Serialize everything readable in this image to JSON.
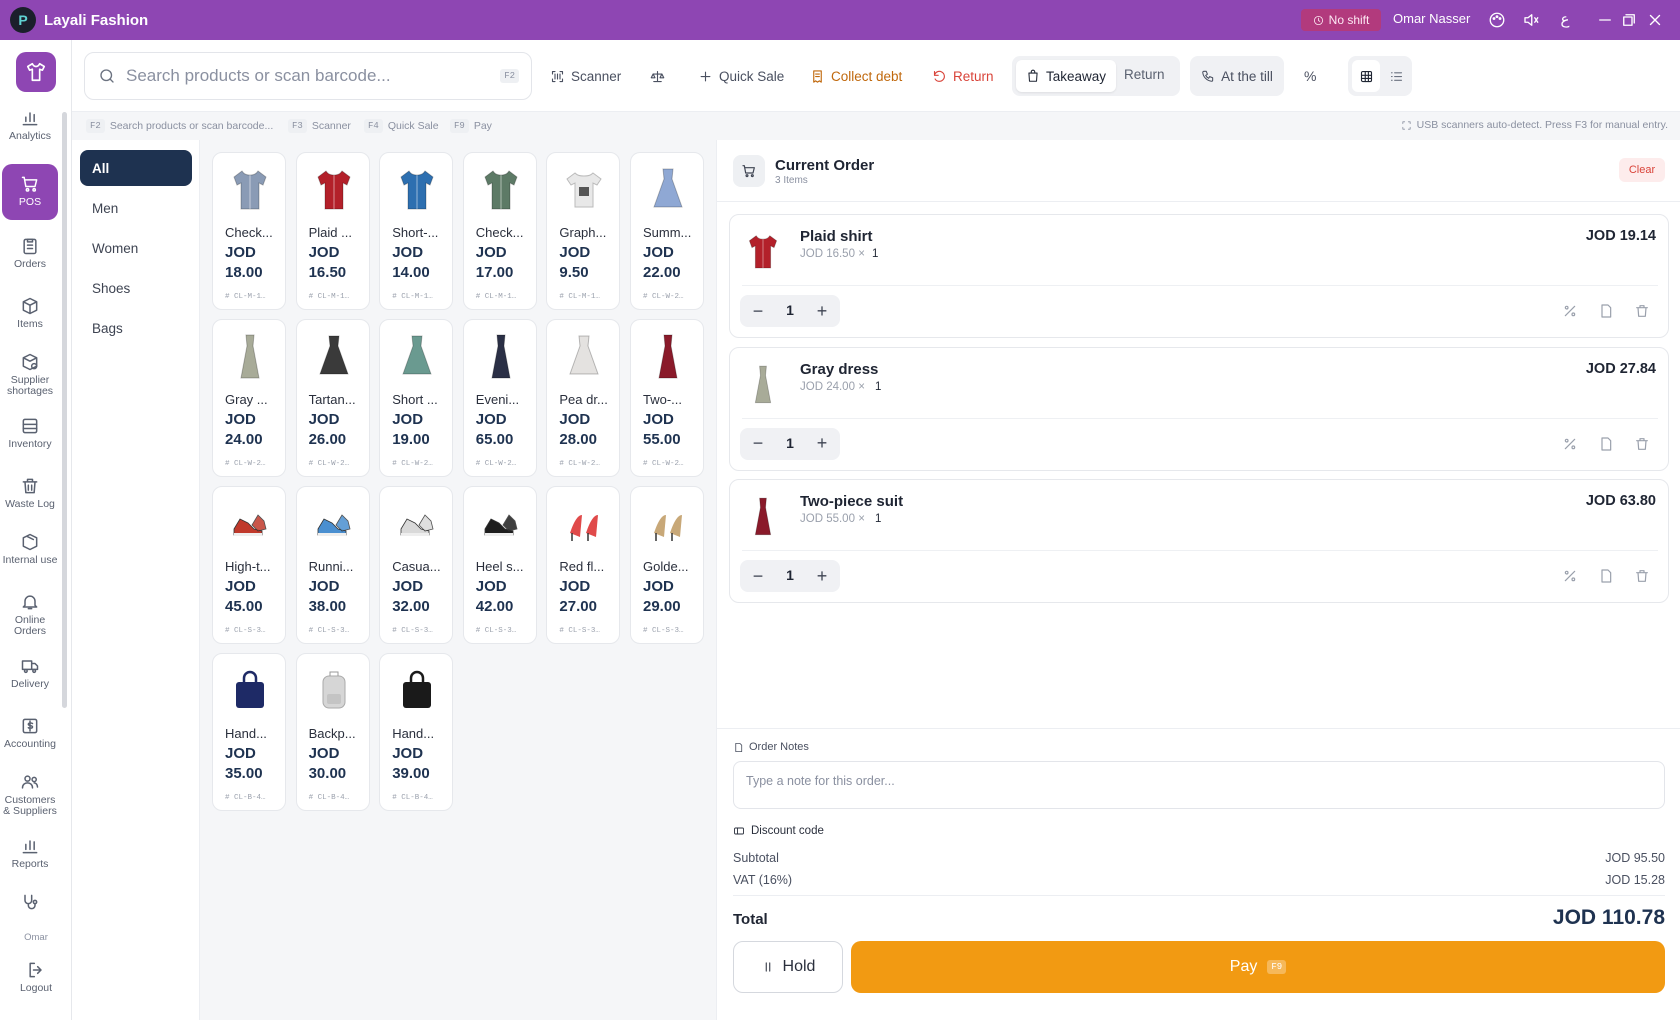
{
  "app": {
    "title": "Layali Fashion",
    "brand_color": "#8e46b3"
  },
  "titlebar": {
    "shift_status": "No shift",
    "user_name": "Omar Nasser"
  },
  "sidebar": {
    "items": [
      {
        "label": "Analytics",
        "icon": "chart-icon"
      },
      {
        "label": "POS",
        "icon": "cart-icon",
        "active": true
      },
      {
        "label": "Orders",
        "icon": "clipboard-icon"
      },
      {
        "label": "Items",
        "icon": "box-icon"
      },
      {
        "label": "Supplier shortages",
        "icon": "box-alert-icon"
      },
      {
        "label": "Inventory",
        "icon": "warehouse-icon"
      },
      {
        "label": "Waste Log",
        "icon": "trash-icon"
      },
      {
        "label": "Internal use",
        "icon": "package-icon"
      },
      {
        "label": "Online Orders",
        "icon": "bell-icon"
      },
      {
        "label": "Delivery",
        "icon": "truck-icon"
      },
      {
        "label": "Accounting",
        "icon": "dollar-icon"
      },
      {
        "label": "Customers & Suppliers",
        "icon": "users-icon"
      },
      {
        "label": "Reports",
        "icon": "bar-chart-icon"
      }
    ],
    "user_short": "Omar",
    "logout_label": "Logout"
  },
  "toolbar": {
    "search_placeholder": "Search products or scan barcode...",
    "search_shortcut": "F2",
    "scanner_label": "Scanner",
    "quick_sale_label": "Quick Sale",
    "collect_debt_label": "Collect debt",
    "return_label": "Return",
    "mode_takeaway": "Takeaway",
    "mode_return": "Return",
    "at_till_label": "At the till",
    "percent_label": "%"
  },
  "hints": {
    "search": {
      "key": "F2",
      "text": "Search products or scan barcode..."
    },
    "scanner": {
      "key": "F3",
      "text": "Scanner"
    },
    "quick_sale": {
      "key": "F4",
      "text": "Quick Sale"
    },
    "pay": {
      "key": "F9",
      "text": "Pay"
    },
    "usb_note": "USB scanners auto-detect. Press F3 for manual entry."
  },
  "categories": [
    "All",
    "Men",
    "Women",
    "Shoes",
    "Bags"
  ],
  "products": [
    {
      "name": "Check...",
      "price": "JOD 18.00",
      "sku": "# CL-M-1…",
      "kind": "shirt",
      "color": "#8a9bb5"
    },
    {
      "name": "Plaid ...",
      "price": "JOD 16.50",
      "sku": "# CL-M-1…",
      "kind": "shirt",
      "color": "#b3202a"
    },
    {
      "name": "Short-...",
      "price": "JOD 14.00",
      "sku": "# CL-M-1…",
      "kind": "shirt",
      "color": "#2d6fb0"
    },
    {
      "name": "Check...",
      "price": "JOD 17.00",
      "sku": "# CL-M-1…",
      "kind": "shirt",
      "color": "#5d7a66"
    },
    {
      "name": "Graph...",
      "price": "JOD 9.50",
      "sku": "# CL-M-1…",
      "kind": "tshirt",
      "color": "#e8e8e8"
    },
    {
      "name": "Summ...",
      "price": "JOD 22.00",
      "sku": "# CL-W-2…",
      "kind": "dress",
      "color": "#8fa8d4"
    },
    {
      "name": "Gray ...",
      "price": "JOD 24.00",
      "sku": "# CL-W-2…",
      "kind": "gown",
      "color": "#a8ab98"
    },
    {
      "name": "Tartan...",
      "price": "JOD 26.00",
      "sku": "# CL-W-2…",
      "kind": "dress",
      "color": "#3a3a3a"
    },
    {
      "name": "Short ...",
      "price": "JOD 19.00",
      "sku": "# CL-W-2…",
      "kind": "dress",
      "color": "#6a9a90"
    },
    {
      "name": "Eveni...",
      "price": "JOD 65.00",
      "sku": "# CL-W-2…",
      "kind": "gown",
      "color": "#2a2f45"
    },
    {
      "name": "Pea dr...",
      "price": "JOD 28.00",
      "sku": "# CL-W-2…",
      "kind": "dress",
      "color": "#e4e2e0"
    },
    {
      "name": "Two-...",
      "price": "JOD 55.00",
      "sku": "# CL-W-2…",
      "kind": "gown",
      "color": "#8a1a2a"
    },
    {
      "name": "High-t...",
      "price": "JOD 45.00",
      "sku": "# CL-S-3…",
      "kind": "shoe",
      "color": "#c0392b"
    },
    {
      "name": "Runni...",
      "price": "JOD 38.00",
      "sku": "# CL-S-3…",
      "kind": "shoe",
      "color": "#4a8fd0"
    },
    {
      "name": "Casua...",
      "price": "JOD 32.00",
      "sku": "# CL-S-3…",
      "kind": "shoe",
      "color": "#d9d9d9"
    },
    {
      "name": "Heel s...",
      "price": "JOD 42.00",
      "sku": "# CL-S-3…",
      "kind": "shoe",
      "color": "#1e1e1e"
    },
    {
      "name": "Red fl...",
      "price": "JOD 27.00",
      "sku": "# CL-S-3…",
      "kind": "heel",
      "color": "#e04a4a"
    },
    {
      "name": "Golde...",
      "price": "JOD 29.00",
      "sku": "# CL-S-3…",
      "kind": "heel",
      "color": "#c8a878"
    },
    {
      "name": "Hand...",
      "price": "JOD 35.00",
      "sku": "# CL-B-4…",
      "kind": "bag",
      "color": "#1e2a66"
    },
    {
      "name": "Backp...",
      "price": "JOD 30.00",
      "sku": "# CL-B-4…",
      "kind": "backpack",
      "color": "#d6d6d6"
    },
    {
      "name": "Hand...",
      "price": "JOD 39.00",
      "sku": "# CL-B-4…",
      "kind": "bag",
      "color": "#1a1a1a"
    }
  ],
  "order": {
    "title": "Current Order",
    "count": "3 Items",
    "clear_label": "Clear",
    "items": [
      {
        "name": "Plaid shirt",
        "unit": "JOD 16.50",
        "times": "×",
        "qty_small": "1",
        "total": "JOD 19.14",
        "qty": "1",
        "kind": "shirt",
        "color": "#b3202a"
      },
      {
        "name": "Gray dress",
        "unit": "JOD 24.00",
        "times": "×",
        "qty_small": "1",
        "total": "JOD 27.84",
        "qty": "1",
        "kind": "gown",
        "color": "#a8ab98"
      },
      {
        "name": "Two-piece suit",
        "unit": "JOD 55.00",
        "times": "×",
        "qty_small": "1",
        "total": "JOD 63.80",
        "qty": "1",
        "kind": "gown",
        "color": "#8a1a2a"
      }
    ],
    "notes_label": "Order Notes",
    "notes_placeholder": "Type a note for this order...",
    "discount_label": "Discount code",
    "subtotal_label": "Subtotal",
    "subtotal": "JOD 95.50",
    "vat_label": "VAT (16%)",
    "vat": "JOD 15.28",
    "total_label": "Total",
    "total": "JOD 110.78",
    "hold_label": "Hold",
    "pay_label": "Pay",
    "pay_shortcut": "F9"
  }
}
